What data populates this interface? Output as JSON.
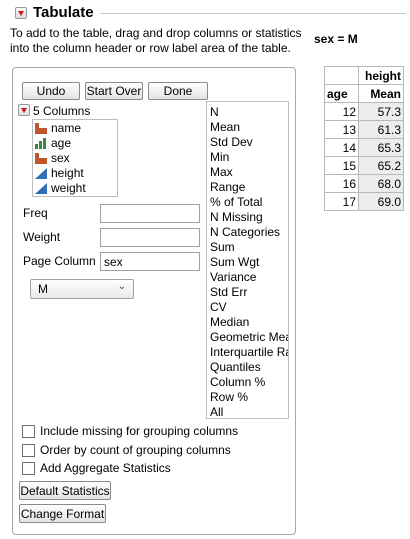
{
  "window": {
    "title": "Tabulate"
  },
  "instructions": "To add to the table, drag and drop columns or statistics into the column header or row label area of the table.",
  "page_label": "sex = M",
  "toolbar": {
    "undo": "Undo",
    "start_over": "Start Over",
    "done": "Done"
  },
  "columns": {
    "header": "5 Columns",
    "items": [
      {
        "label": "name",
        "icon": "nominal-icon"
      },
      {
        "label": "age",
        "icon": "ordinal-icon"
      },
      {
        "label": "sex",
        "icon": "nominal-icon"
      },
      {
        "label": "height",
        "icon": "continuous-icon"
      },
      {
        "label": "weight",
        "icon": "continuous-icon"
      }
    ]
  },
  "statistics": [
    "N",
    "Mean",
    "Std Dev",
    "Min",
    "Max",
    "Range",
    "% of Total",
    "N Missing",
    "N Categories",
    "Sum",
    "Sum Wgt",
    "Variance",
    "Std Err",
    "CV",
    "Median",
    "Geometric Mean",
    "Interquartile Range",
    "Quantiles",
    "Column %",
    "Row %",
    "All"
  ],
  "fields": {
    "freq": {
      "label": "Freq",
      "value": ""
    },
    "weight": {
      "label": "Weight",
      "value": ""
    },
    "page": {
      "label": "Page Column",
      "value": "sex"
    }
  },
  "page_select": {
    "value": "M"
  },
  "checkboxes": [
    {
      "label": "Include missing for grouping columns",
      "checked": false
    },
    {
      "label": "Order by count of grouping columns",
      "checked": false
    },
    {
      "label": "Add Aggregate Statistics",
      "checked": false
    }
  ],
  "bottom_buttons": {
    "default_stats": "Default Statistics",
    "change_format": "Change Format"
  },
  "table": {
    "col_header": "height",
    "row_header": "age",
    "stat_header": "Mean",
    "rows": [
      {
        "age": "12",
        "mean": "57.3"
      },
      {
        "age": "13",
        "mean": "61.3"
      },
      {
        "age": "14",
        "mean": "65.3"
      },
      {
        "age": "15",
        "mean": "65.2"
      },
      {
        "age": "16",
        "mean": "68.0"
      },
      {
        "age": "17",
        "mean": "69.0"
      }
    ]
  },
  "colors": {
    "nominal": "#c0562b",
    "ordinal": "#3c8a3c",
    "continuous": "#2f6fb6",
    "accent_red": "#d01818"
  }
}
